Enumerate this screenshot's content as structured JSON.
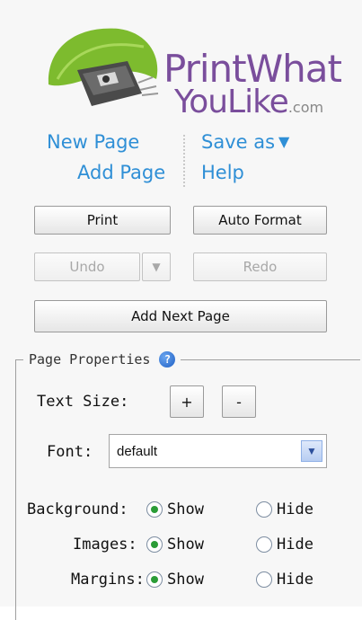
{
  "logo": {
    "line1": "PrintWhat",
    "line2": "YouLike",
    "suffix": ".com"
  },
  "links": {
    "new_page": "New Page",
    "add_page": "Add Page",
    "save_as": "Save as",
    "save_as_caret": "▼",
    "help": "Help"
  },
  "buttons": {
    "print": "Print",
    "auto_format": "Auto Format",
    "undo": "Undo",
    "undo_dropdown": "▼",
    "redo": "Redo",
    "add_next_page": "Add Next Page"
  },
  "page_properties": {
    "legend": "Page Properties",
    "help_icon": "?",
    "text_size_label": "Text Size:",
    "increase": "+",
    "decrease": "-",
    "font_label": "Font:",
    "font_value": "default",
    "font_dropdown_icon": "▼",
    "options": [
      {
        "label": "Background:",
        "show": "Show",
        "hide": "Hide",
        "selected": "show"
      },
      {
        "label": "Images:",
        "show": "Show",
        "hide": "Hide",
        "selected": "show"
      },
      {
        "label": "Margins:",
        "show": "Show",
        "hide": "Hide",
        "selected": "show"
      }
    ]
  },
  "colors": {
    "link": "#2f8fd6",
    "logo_purple": "#7a4e9c",
    "radio_checked": "#2b9c36"
  }
}
